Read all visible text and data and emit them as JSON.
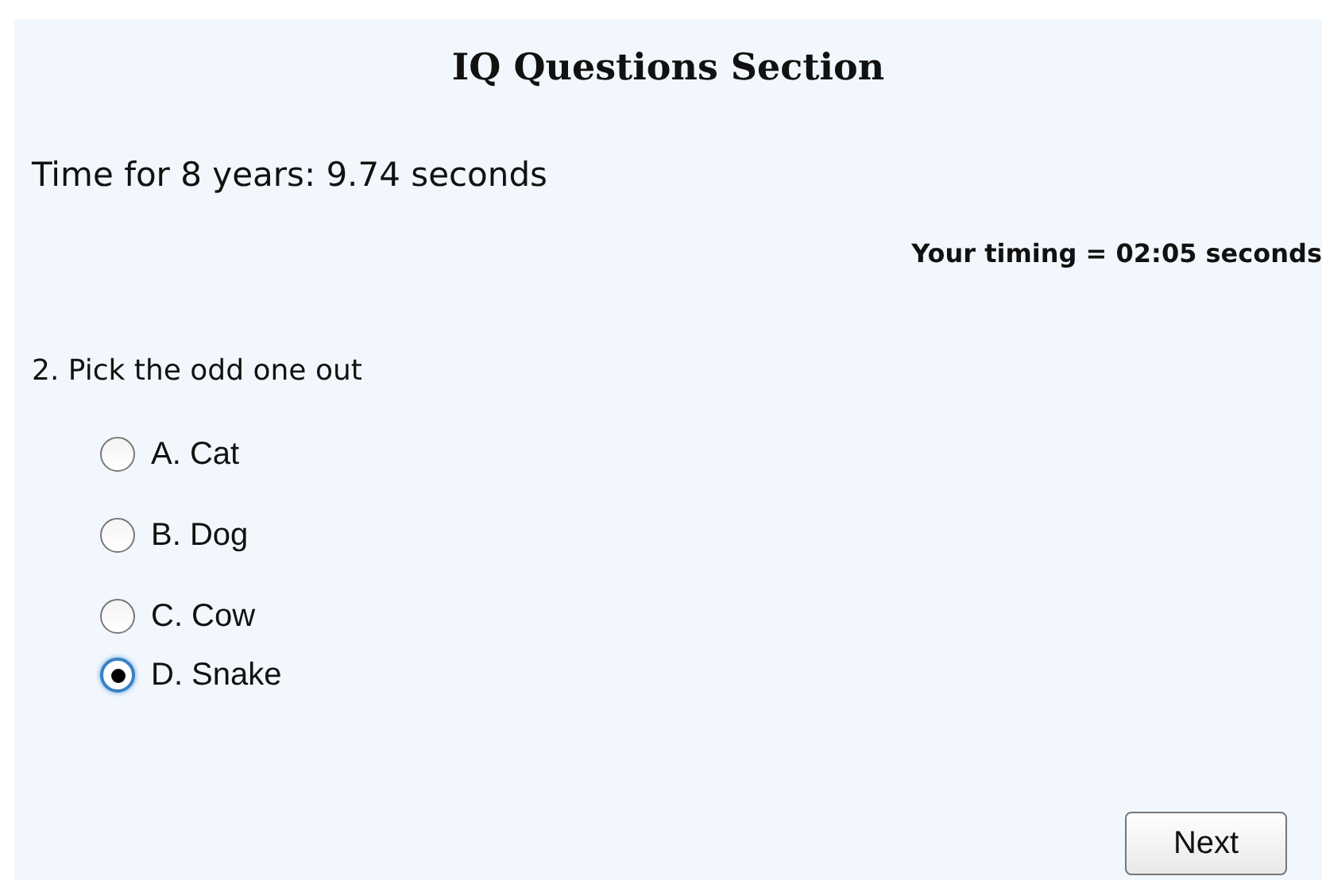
{
  "title": "IQ Questions Section",
  "time_info": "Time for 8 years: 9.74 seconds",
  "timing": "Your timing = 02:05 seconds",
  "question": "2. Pick the odd one out",
  "options": [
    {
      "label": "A. Cat",
      "selected": false
    },
    {
      "label": "B. Dog",
      "selected": false
    },
    {
      "label": "C. Cow",
      "selected": false
    },
    {
      "label": "D. Snake",
      "selected": true
    }
  ],
  "next_button": "Next"
}
